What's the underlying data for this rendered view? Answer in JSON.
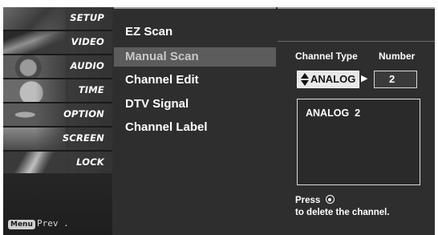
{
  "left_menu": {
    "items": [
      {
        "label": "SETUP",
        "icon": "setup-icon"
      },
      {
        "label": "VIDEO",
        "icon": "video-icon"
      },
      {
        "label": "AUDIO",
        "icon": "audio-icon"
      },
      {
        "label": "TIME",
        "icon": "clock-icon"
      },
      {
        "label": "OPTION",
        "icon": "option-icon"
      },
      {
        "label": "SCREEN",
        "icon": "screen-icon"
      },
      {
        "label": "LOCK",
        "icon": "lock-icon"
      }
    ],
    "footer_key": "Menu",
    "footer_label": "Prev ."
  },
  "submenu": {
    "items": [
      {
        "label": "EZ Scan"
      },
      {
        "label": "Manual Scan"
      },
      {
        "label": "Channel Edit"
      },
      {
        "label": "DTV Signal"
      },
      {
        "label": "Channel Label"
      }
    ],
    "selected_index": 1
  },
  "manual_scan": {
    "type_label": "Channel Type",
    "number_label": "Number",
    "type_value": "ANALOG",
    "number_value": "2",
    "channel_entry": "ANALOG  2",
    "press_text": "Press",
    "hint_text": "to delete the channel."
  },
  "colors": {
    "background": "#2f2f2f",
    "highlight": "#5c5c5c",
    "type_box": "#e8e8e8"
  }
}
